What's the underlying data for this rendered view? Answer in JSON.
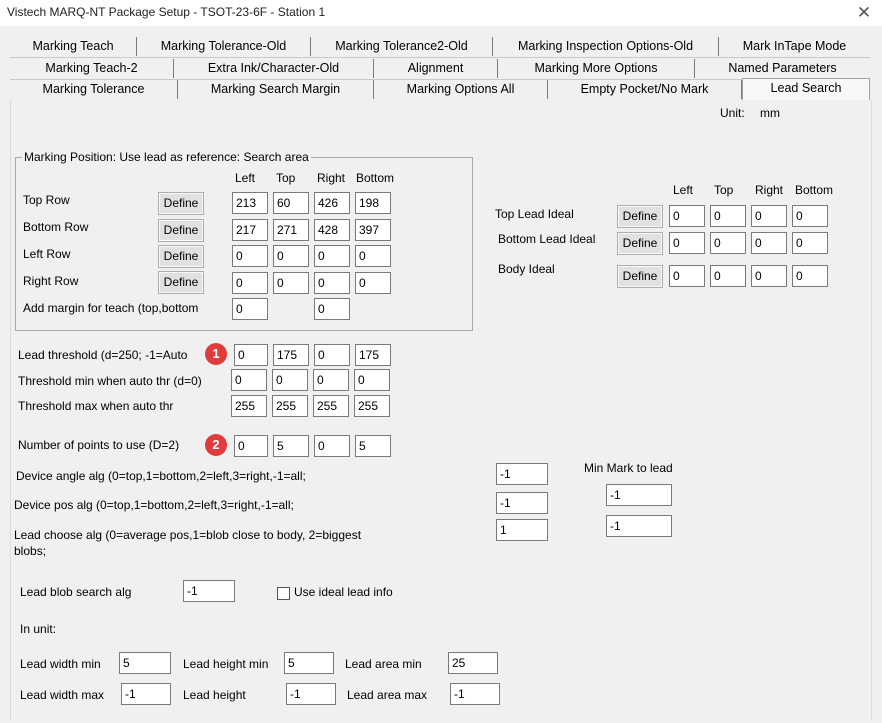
{
  "window": {
    "title": "Vistech MARQ-NT Package Setup - TSOT-23-6F - Station 1"
  },
  "tabs": {
    "row1": [
      "Marking Teach",
      "Marking Tolerance-Old",
      "Marking Tolerance2-Old",
      "Marking Inspection Options-Old",
      "Mark InTape Mode"
    ],
    "row2": [
      "Marking Teach-2",
      "Extra Ink/Character-Old",
      "Alignment",
      "Marking More Options",
      "Named Parameters"
    ],
    "row3": [
      "Marking Tolerance",
      "Marking Search Margin",
      "Marking Options All",
      "Empty Pocket/No Mark",
      "Lead Search"
    ]
  },
  "unit_label": "Unit:",
  "unit_value": "mm",
  "marking_position": {
    "legend": "Marking Position: Use lead as reference: Search area",
    "headers": [
      "Left",
      "Top",
      "Right",
      "Bottom"
    ],
    "define_label": "Define",
    "rows": [
      {
        "label": "Top Row",
        "values": [
          "213",
          "60",
          "426",
          "198"
        ]
      },
      {
        "label": "Bottom Row",
        "values": [
          "217",
          "271",
          "428",
          "397"
        ]
      },
      {
        "label": "Left Row",
        "values": [
          "0",
          "0",
          "0",
          "0"
        ]
      },
      {
        "label": "Right Row",
        "values": [
          "0",
          "0",
          "0",
          "0"
        ]
      }
    ],
    "margin_label": "Add margin for teach (top,bottom",
    "margin_values": [
      "0",
      "0"
    ]
  },
  "ideal": {
    "headers": [
      "Left",
      "Top",
      "Right",
      "Bottom"
    ],
    "define_label": "Define",
    "rows": [
      {
        "label": "Top Lead Ideal",
        "values": [
          "0",
          "0",
          "0",
          "0"
        ]
      },
      {
        "label": "Bottom Lead Ideal",
        "values": [
          "0",
          "0",
          "0",
          "0"
        ]
      },
      {
        "label": "Body Ideal",
        "values": [
          "0",
          "0",
          "0",
          "0"
        ]
      }
    ]
  },
  "threshold": {
    "lead_label": "Lead threshold (d=250; -1=Auto",
    "lead_values": [
      "0",
      "175",
      "0",
      "175"
    ],
    "min_label": "Threshold min when auto thr (d=0)",
    "min_values": [
      "0",
      "0",
      "0",
      "0"
    ],
    "max_label": "Threshold max when auto thr",
    "max_values": [
      "255",
      "255",
      "255",
      "255"
    ]
  },
  "points": {
    "label": "Number of points to use (D=2)",
    "values": [
      "0",
      "5",
      "0",
      "5"
    ]
  },
  "markers": [
    "1",
    "2"
  ],
  "algs": {
    "angle_label": "Device angle alg (0=top,1=bottom,2=left,3=right,-1=all;",
    "angle_value": "-1",
    "pos_label": "Device pos alg (0=top,1=bottom,2=left,3=right,-1=all;",
    "pos_value": "-1",
    "choose_label_1": "Lead choose alg (0=average pos,1=blob close to body, 2=biggest",
    "choose_label_2": "blobs;",
    "choose_value": "1"
  },
  "min_mark": {
    "label": "Min Mark to lead",
    "values": [
      "-1",
      "-1"
    ]
  },
  "blob": {
    "label": "Lead blob search alg",
    "value": "-1",
    "ideal_checkbox_label": "Use ideal lead info",
    "ideal_checked": false
  },
  "in_unit_label": "In unit:",
  "dims": {
    "width_min_label": "Lead width min",
    "width_min": "5",
    "height_min_label": "Lead height min",
    "height_min": "5",
    "area_min_label": "Lead area min",
    "area_min": "25",
    "width_max_label": "Lead width max",
    "width_max": "-1",
    "height_label": "Lead height",
    "height": "-1",
    "area_max_label": "Lead area max",
    "area_max": "-1"
  }
}
